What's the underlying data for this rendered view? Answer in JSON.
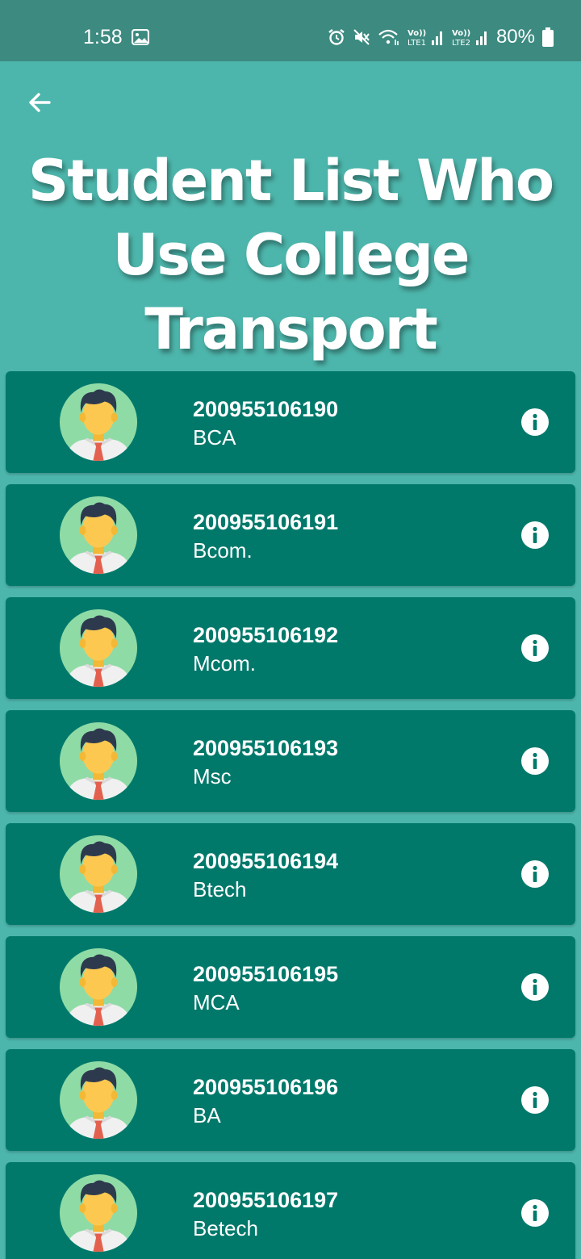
{
  "status_bar": {
    "time": "1:58",
    "battery": "80%",
    "icons": [
      "image-icon",
      "alarm-icon",
      "mute-icon",
      "wifi-icon",
      "volte-lte1-signal-icon",
      "volte-lte2-signal-icon",
      "battery-icon"
    ]
  },
  "header": {
    "back_icon": "arrow-left-icon",
    "title": "Student List Who Use College Transport"
  },
  "colors": {
    "status_bar": "#3C8A80",
    "background": "#4DB6AC",
    "card": "#00796B",
    "text": "#FFFFFF"
  },
  "students": [
    {
      "id": "200955106190",
      "course": "BCA"
    },
    {
      "id": "200955106191",
      "course": "Bcom."
    },
    {
      "id": "200955106192",
      "course": "Mcom."
    },
    {
      "id": "200955106193",
      "course": "Msc"
    },
    {
      "id": "200955106194",
      "course": "Btech"
    },
    {
      "id": "200955106195",
      "course": "MCA"
    },
    {
      "id": "200955106196",
      "course": "BA"
    },
    {
      "id": "200955106197",
      "course": "Betech"
    }
  ]
}
